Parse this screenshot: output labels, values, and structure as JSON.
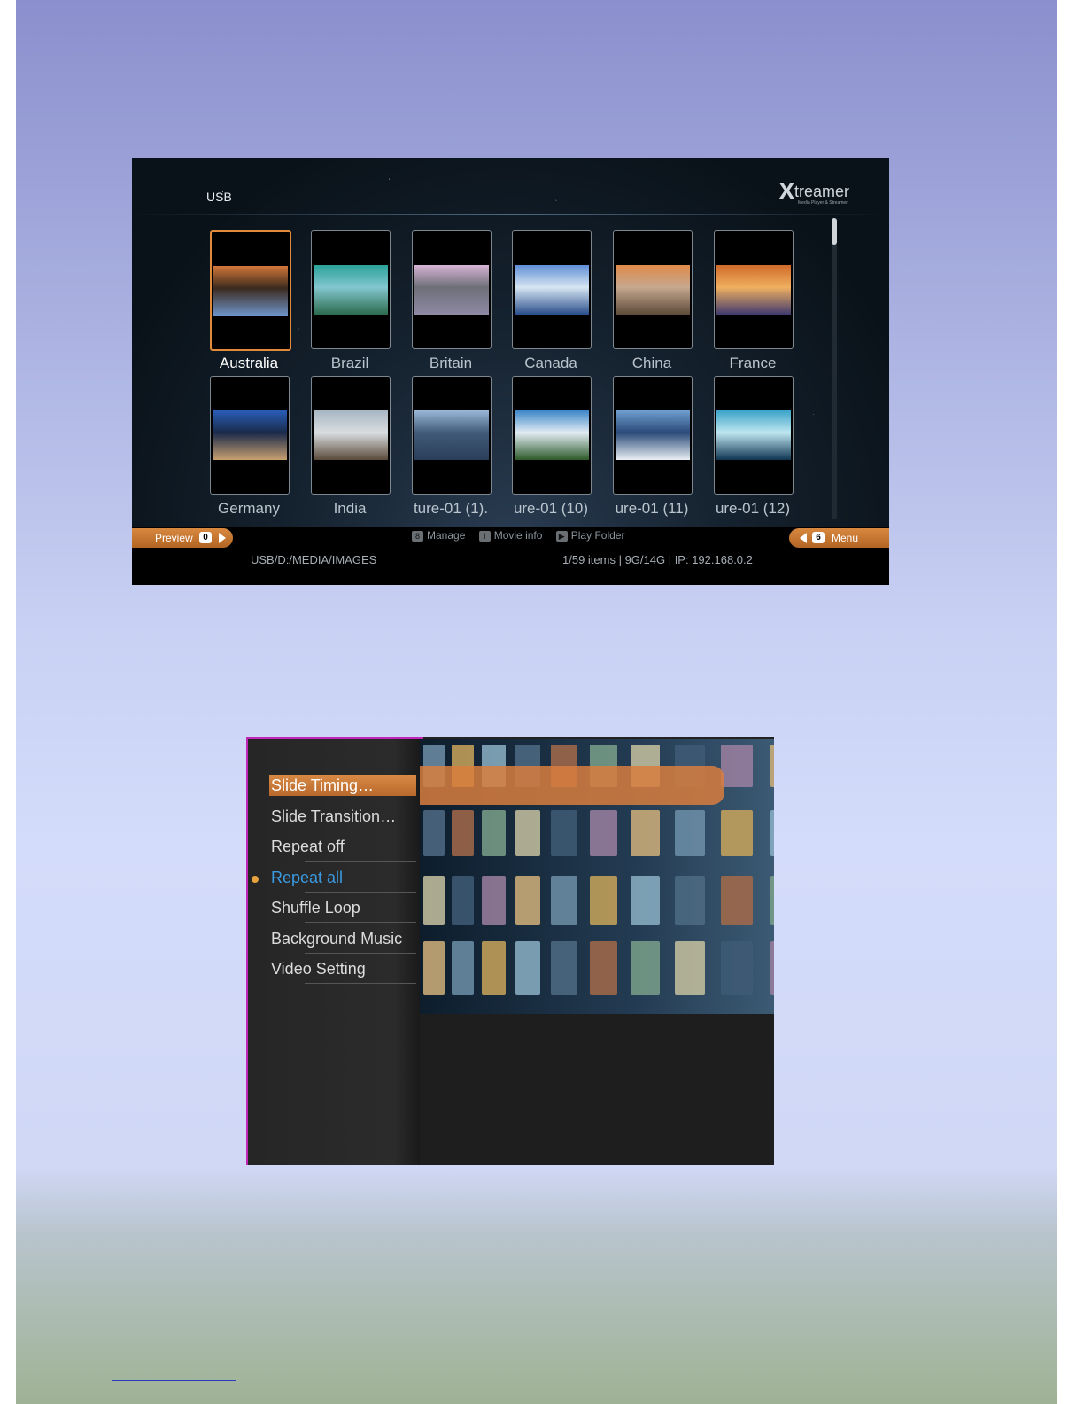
{
  "browser": {
    "source": "USB",
    "brand": {
      "mark": "X",
      "name": "treamer",
      "tagline": "Media Player & Streamer"
    },
    "folders": [
      {
        "label": "Australia",
        "selected": true,
        "colors": [
          "#d4773a",
          "#6e94c8",
          "#3b2a1e"
        ]
      },
      {
        "label": "Brazil",
        "colors": [
          "#2aa19a",
          "#2c6b4e",
          "#83c7cf"
        ]
      },
      {
        "label": "Britain",
        "colors": [
          "#d7b4d6",
          "#8f8aa6",
          "#6d6f77"
        ]
      },
      {
        "label": "Canada",
        "colors": [
          "#5f8fd6",
          "#2a4e8c",
          "#d7e6f2"
        ]
      },
      {
        "label": "China",
        "colors": [
          "#e08a4a",
          "#5d4a3a",
          "#c5a88f"
        ]
      },
      {
        "label": "France",
        "colors": [
          "#cf6a2a",
          "#403a6e",
          "#f0b060"
        ]
      },
      {
        "label": "Germany",
        "colors": [
          "#2a5db8",
          "#c8a070",
          "#1a2a4a"
        ]
      },
      {
        "label": "India",
        "colors": [
          "#a7b6c3",
          "#5a4a3a",
          "#d9dde0"
        ]
      },
      {
        "label": "ture-01 (1).",
        "colors": [
          "#9ab8d8",
          "#2a3e5a",
          "#405a78"
        ]
      },
      {
        "label": "ure-01 (10)",
        "colors": [
          "#3b86c8",
          "#2d5a2a",
          "#e2ecf3"
        ]
      },
      {
        "label": "ure-01 (11)",
        "colors": [
          "#6f9fd0",
          "#e9eff4",
          "#2a4a78"
        ]
      },
      {
        "label": "ure-01 (12)",
        "colors": [
          "#3aa3c9",
          "#0e3552",
          "#bfe6f0"
        ]
      }
    ],
    "footer": {
      "preview_label": "Preview",
      "preview_key": "0",
      "menu_key": "6",
      "menu_label": "Menu",
      "hints": [
        {
          "key": "8",
          "label": "Manage"
        },
        {
          "key": "i",
          "label": "Movie info"
        },
        {
          "key": "▶",
          "label": "Play Folder"
        }
      ],
      "path": "USB/D:/MEDIA/IMAGES",
      "status": "1/59 items | 9G/14G | IP: 192.168.0.2"
    }
  },
  "slideshow_menu": {
    "items": [
      {
        "label": "Slide Timing…",
        "state": "selected"
      },
      {
        "label": "Slide Transition…",
        "state": "normal"
      },
      {
        "label": "Repeat off",
        "state": "normal"
      },
      {
        "label": "Repeat all",
        "state": "active"
      },
      {
        "label": "Shuffle Loop",
        "state": "normal"
      },
      {
        "label": "Background Music",
        "state": "normal"
      },
      {
        "label": "Video Setting",
        "state": "normal"
      }
    ]
  },
  "colors": {
    "accent_orange": "#d8883f",
    "active_blue": "#3a9ae0",
    "frame_magenta": "#c026b8"
  }
}
